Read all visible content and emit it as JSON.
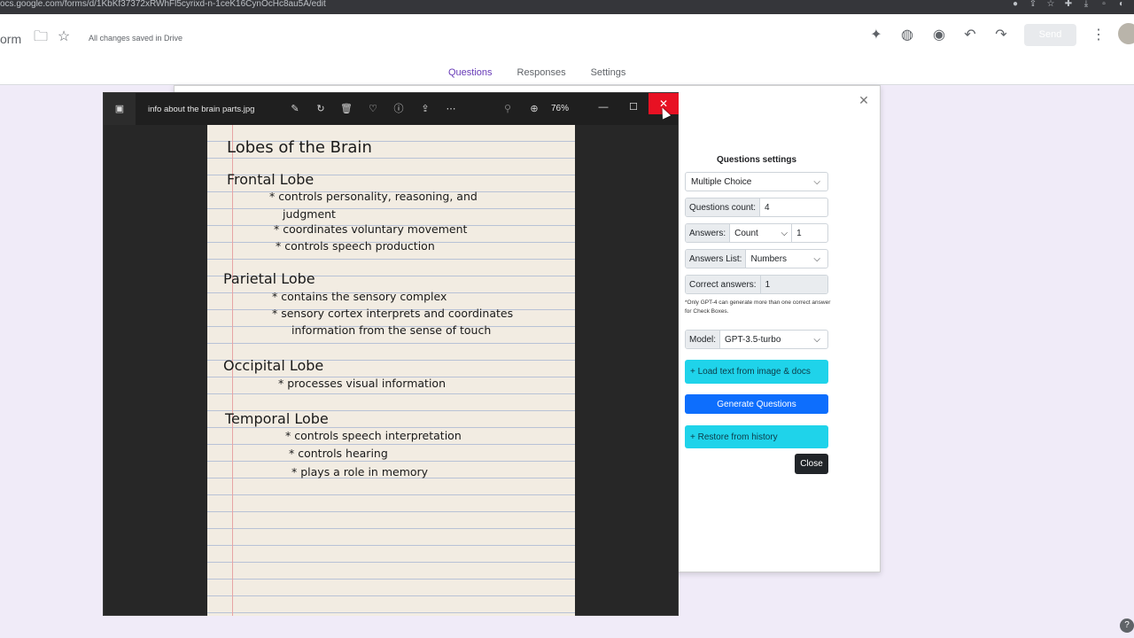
{
  "browser": {
    "url": "ocs.google.com/forms/d/1KbKf37372xRWhFl5cyrixd-n-1ceK16CynOcHc8au5A/edit"
  },
  "forms_header": {
    "title": "orm",
    "saved_status": "All changes saved in Drive",
    "send_label": "Send",
    "tabs": [
      {
        "label": "Questions",
        "active": true
      },
      {
        "label": "Responses",
        "active": false
      },
      {
        "label": "Settings",
        "active": false
      }
    ]
  },
  "viewer": {
    "filename": "info about the brain parts.jpg",
    "zoom": "76%",
    "tools": [
      "edit-image-icon",
      "rotate-icon",
      "delete-icon",
      "favorite-icon",
      "info-icon",
      "share-icon",
      "more-icon"
    ]
  },
  "photo": {
    "title": "Lobes of the Brain",
    "sections": [
      {
        "heading": "Frontal Lobe",
        "lines": [
          "* controls personality, reasoning, and",
          "judgment",
          "* coordinates voluntary movement",
          "* controls speech production"
        ]
      },
      {
        "heading": "Parietal Lobe",
        "lines": [
          "* contains the sensory complex",
          "* sensory cortex interprets and coordinates",
          "information from the sense of touch"
        ]
      },
      {
        "heading": "Occipital Lobe",
        "lines": [
          "* processes visual information"
        ]
      },
      {
        "heading": "Temporal Lobe",
        "lines": [
          "* controls speech interpretation",
          "* controls hearing",
          "* plays a role in memory"
        ]
      }
    ]
  },
  "settings": {
    "title": "Questions settings",
    "question_type": "Multiple Choice",
    "questions_count_label": "Questions count:",
    "questions_count": "4",
    "answers_label": "Answers:",
    "answers_mode": "Count",
    "answers_value": "1",
    "answers_list_label": "Answers List:",
    "answers_list": "Numbers",
    "correct_answers_label": "Correct answers:",
    "correct_answers": "1",
    "note": "*Only GPT-4 can generate more than one correct answer for Check Boxes.",
    "model_label": "Model:",
    "model": "GPT-3.5-turbo",
    "load_button": "+ Load text from image & docs",
    "generate_button": "Generate Questions",
    "restore_button": "+ Restore from history",
    "close_button": "Close"
  },
  "colors": {
    "page_bg": "#f0ebf8",
    "accent": "#673ab7",
    "cyan_button": "#1fd3ea",
    "blue_button": "#0d6efd",
    "close_red": "#e81123"
  }
}
